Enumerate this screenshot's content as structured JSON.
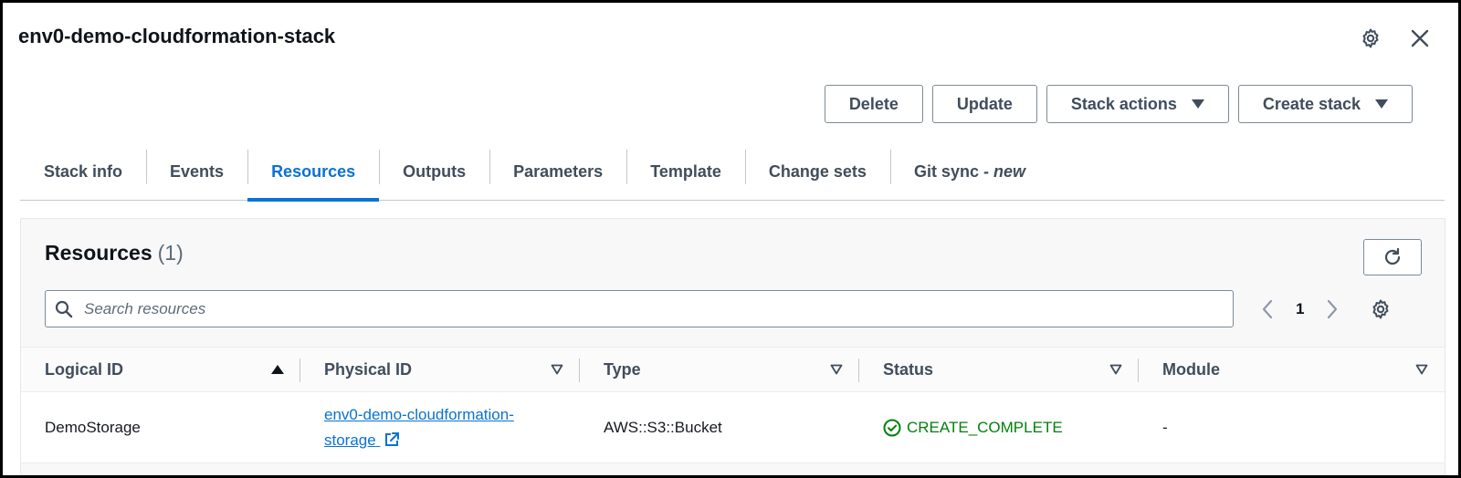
{
  "header": {
    "title": "env0-demo-cloudformation-stack",
    "settings_icon": "gear-icon",
    "close_icon": "close-icon"
  },
  "actions": {
    "delete": "Delete",
    "update": "Update",
    "stack_actions": "Stack actions",
    "create_stack": "Create stack"
  },
  "tabs": [
    {
      "label": "Stack info"
    },
    {
      "label": "Events"
    },
    {
      "label": "Resources"
    },
    {
      "label": "Outputs"
    },
    {
      "label": "Parameters"
    },
    {
      "label": "Template"
    },
    {
      "label": "Change sets"
    },
    {
      "label": "Git sync - ",
      "badge": "new"
    }
  ],
  "active_tab": "Resources",
  "resources": {
    "title": "Resources",
    "count": "(1)",
    "search_placeholder": "Search resources",
    "page": "1",
    "columns": [
      "Logical ID",
      "Physical ID",
      "Type",
      "Status",
      "Module"
    ],
    "rows": [
      {
        "logical_id": "DemoStorage",
        "physical_id_line1": "env0-demo-cloudformation-",
        "physical_id_line2": "storage",
        "type": "AWS::S3::Bucket",
        "status": "CREATE_COMPLETE",
        "module": "-"
      }
    ]
  },
  "colors": {
    "accent": "#0972d3",
    "success": "#037f0c",
    "text": "#414d5c"
  }
}
